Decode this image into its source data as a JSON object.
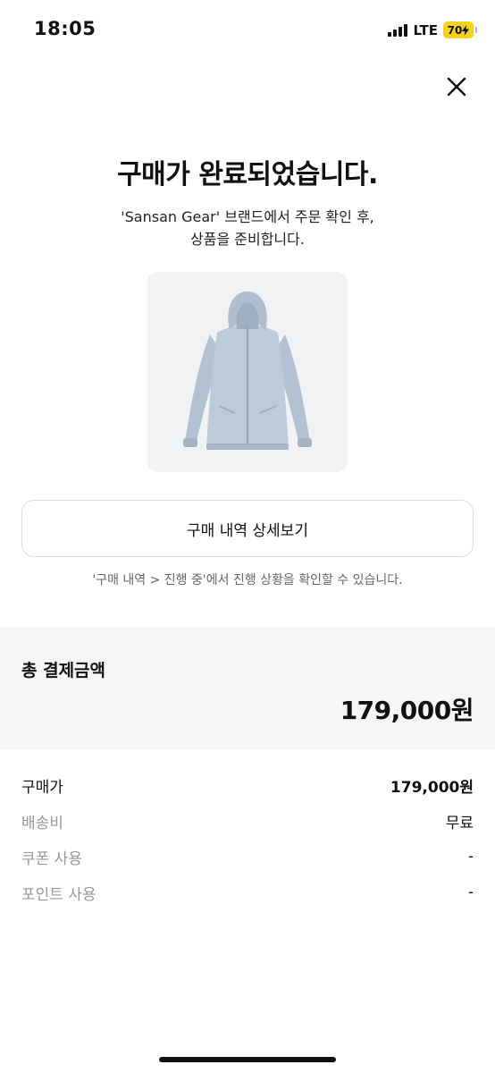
{
  "status_bar": {
    "time": "18:05",
    "network": "LTE",
    "battery": "70",
    "icons": [
      "signal-icon",
      "battery-icon",
      "charging-bolt-icon"
    ]
  },
  "header": {
    "close_icon": "close-icon"
  },
  "confirmation": {
    "title": "구매가 완료되었습니다.",
    "subtitle_line1": "'Sansan Gear' 브랜드에서 주문 확인 후,",
    "subtitle_line2": "상품을 준비합니다."
  },
  "product": {
    "image_icon": "jacket-image",
    "colors": {
      "jacket": "#b9c7d6",
      "background": "#f1f2f3"
    }
  },
  "actions": {
    "detail_button_label": "구매 내역 상세보기",
    "info_note": "'구매 내역 > 진행 중'에서 진행 상황을 확인할 수 있습니다."
  },
  "total": {
    "label": "총 결제금액",
    "amount": "179,000원"
  },
  "summary": {
    "rows": [
      {
        "label": "구매가",
        "value": "179,000원"
      },
      {
        "label": "배송비",
        "value": "무료"
      },
      {
        "label": "쿠폰 사용",
        "value": "-"
      },
      {
        "label": "포인트 사용",
        "value": "-"
      }
    ]
  }
}
